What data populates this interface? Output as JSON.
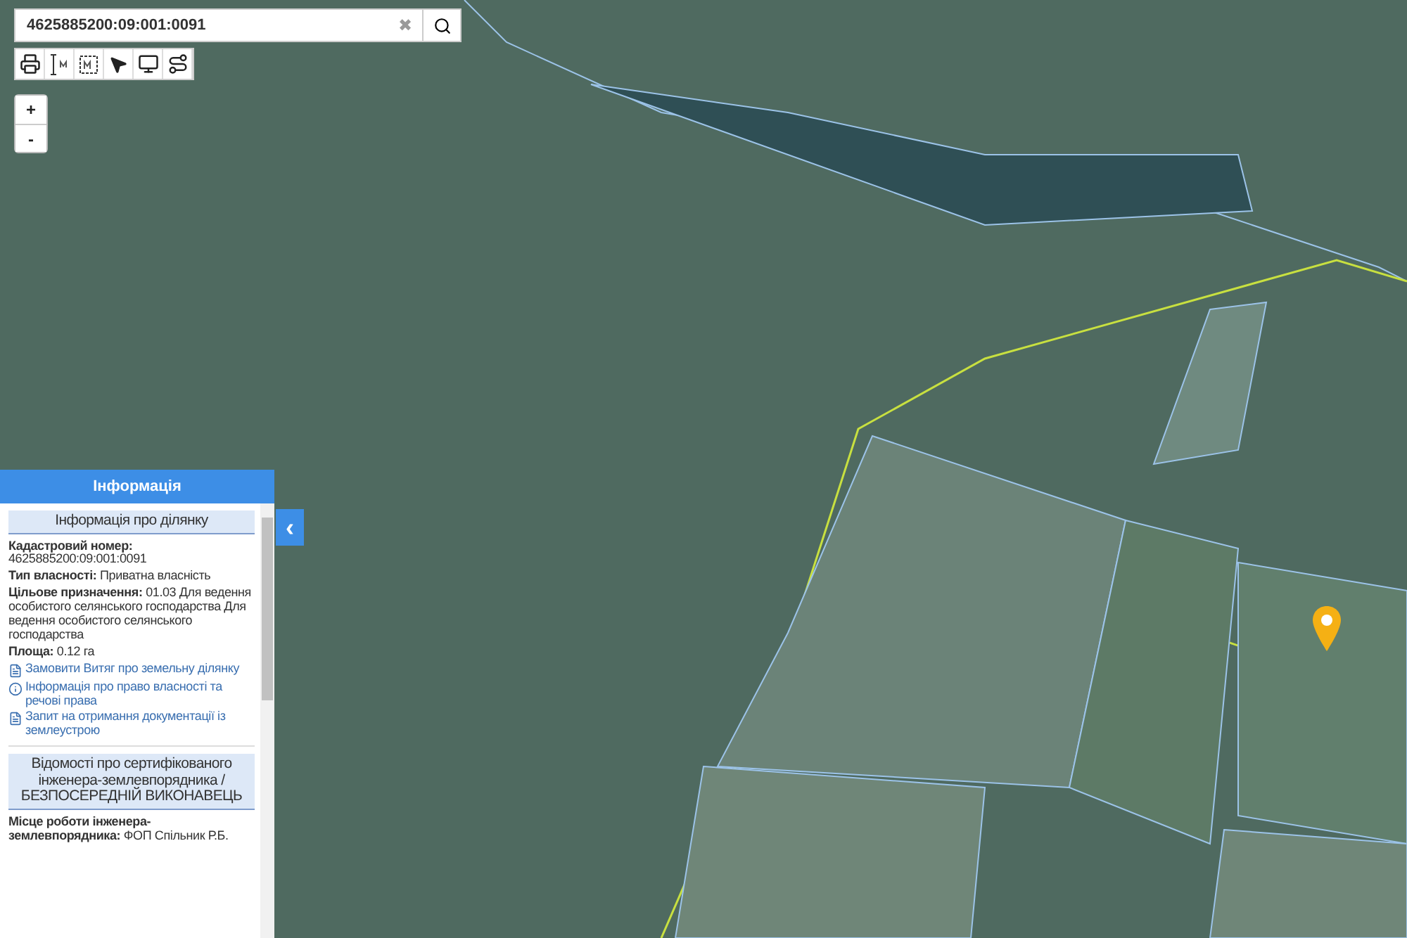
{
  "search": {
    "value": "4625885200:09:001:0091",
    "clear": "✖"
  },
  "zoom": {
    "in": "+",
    "out": "-"
  },
  "panel": {
    "title": "Інформація",
    "collapse": "‹",
    "section_title": "Інформація про ділянку",
    "fields": [
      {
        "label": "Кадастровий номер:",
        "value": "4625885200:09:001:0091"
      },
      {
        "label": "Тип власності:",
        "value": "Приватна власність"
      },
      {
        "label": "Цільове призначення:",
        "value": "01.03 Для ведення особистого селянського господарства Для ведення особистого селянського господарства"
      },
      {
        "label": "Площа:",
        "value": "0.12 га"
      }
    ],
    "links": [
      {
        "kind": "doc",
        "text": "Замовити Витяг про земельну ділянку"
      },
      {
        "kind": "info",
        "text": "Інформація про право власності та речові права"
      },
      {
        "kind": "doc",
        "text": "Запит на отримання документації із землеустрою"
      }
    ],
    "engineer_title": "Відомості про сертифікованого інженера-землевпорядника / БЕЗПОСЕРЕДНІЙ ВИКОНАВЕЦЬ",
    "engineer_fields": [
      {
        "label": "Місце роботи інженера-землевпорядника:",
        "value": "ФОП Спільник Р.Б."
      }
    ]
  }
}
